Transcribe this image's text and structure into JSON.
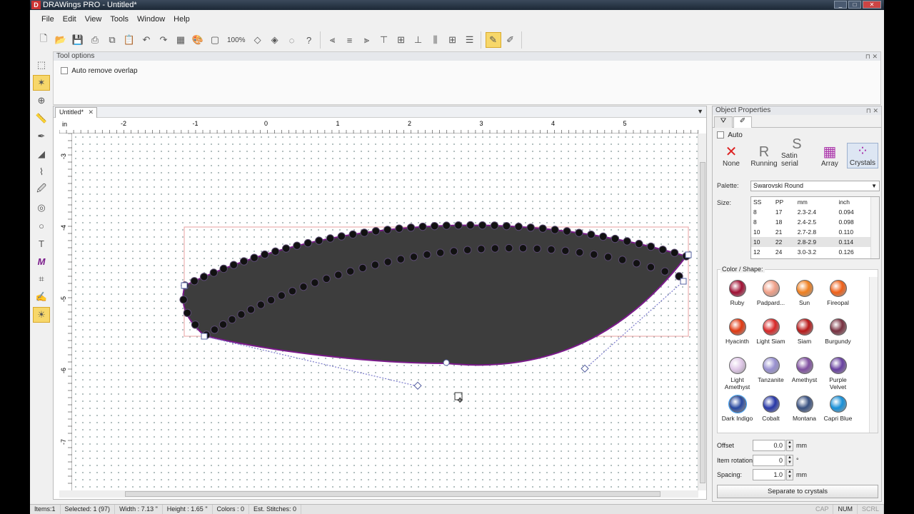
{
  "window": {
    "title": "DRAWings PRO - Untitled*"
  },
  "menu": [
    "File",
    "Edit",
    "View",
    "Tools",
    "Window",
    "Help"
  ],
  "toolbar": {
    "zoom": "100%"
  },
  "tool_options": {
    "title": "Tool options",
    "auto_remove_overlap": "Auto remove overlap"
  },
  "document": {
    "tab": "Untitled*",
    "ruler_unit": "in",
    "h_ticks": [
      "-2",
      "-1",
      "0",
      "1",
      "2",
      "3",
      "4",
      "5"
    ],
    "v_ticks": [
      "-3",
      "-4",
      "-5",
      "-6",
      "-7"
    ]
  },
  "props": {
    "title": "Object Properties",
    "auto": "Auto",
    "modes": [
      {
        "label": "None",
        "icon": "✕",
        "color": "#d22"
      },
      {
        "label": "Running",
        "icon": "R",
        "color": "#777"
      },
      {
        "label": "Satin serial",
        "icon": "S",
        "color": "#777"
      },
      {
        "label": "Array",
        "icon": "▦",
        "color": "#a3a"
      },
      {
        "label": "Crystals",
        "icon": "⁘",
        "color": "#a3a"
      }
    ],
    "palette_label": "Palette:",
    "palette_value": "Swarovski Round",
    "size_label": "Size:",
    "size_headers": [
      "SS",
      "PP",
      "mm",
      "inch"
    ],
    "size_rows": [
      [
        "8",
        "17",
        "2.3-2.4",
        "0.094"
      ],
      [
        "8",
        "18",
        "2.4-2.5",
        "0.098"
      ],
      [
        "10",
        "21",
        "2.7-2.8",
        "0.110"
      ],
      [
        "10",
        "22",
        "2.8-2.9",
        "0.114"
      ],
      [
        "12",
        "24",
        "3.0-3.2",
        "0.126"
      ]
    ],
    "color_legend": "Color / Shape:",
    "colors": [
      {
        "name": "Ruby",
        "hex": "#a01034"
      },
      {
        "name": "Padpard...",
        "hex": "#f0a088"
      },
      {
        "name": "Sun",
        "hex": "#f08020"
      },
      {
        "name": "Fireopal",
        "hex": "#f06018"
      },
      {
        "name": "Hyacinth",
        "hex": "#e03810"
      },
      {
        "name": "Light Siam",
        "hex": "#d82828"
      },
      {
        "name": "Siam",
        "hex": "#b81818"
      },
      {
        "name": "Burgundy",
        "hex": "#783040"
      },
      {
        "name": "Light Amethyst",
        "hex": "#e0c8e8"
      },
      {
        "name": "Tanzanite",
        "hex": "#9890d0"
      },
      {
        "name": "Amethyst",
        "hex": "#8050a0"
      },
      {
        "name": "Purple Velvet",
        "hex": "#6840a0"
      },
      {
        "name": "Dark Indigo",
        "hex": "#2848a0"
      },
      {
        "name": "Cobalt",
        "hex": "#2838a8"
      },
      {
        "name": "Montana",
        "hex": "#385080"
      },
      {
        "name": "Capri Blue",
        "hex": "#1890d8"
      }
    ],
    "offset": {
      "label": "Offset",
      "value": "0.0",
      "unit": "mm"
    },
    "rotation": {
      "label": "Item rotation",
      "value": "0",
      "unit": "°"
    },
    "spacing": {
      "label": "Spacing:",
      "value": "1.0",
      "unit": "mm"
    },
    "separate": "Separate to crystals"
  },
  "status": {
    "items": "Items:1",
    "selected": "Selected: 1 (97)",
    "width": "Width : 7.13 \"",
    "height": "Height : 1.65 \"",
    "colors": "Colors : 0",
    "stitches": "Est. Stitches: 0",
    "cap": "CAP",
    "num": "NUM",
    "scrl": "SCRL"
  }
}
